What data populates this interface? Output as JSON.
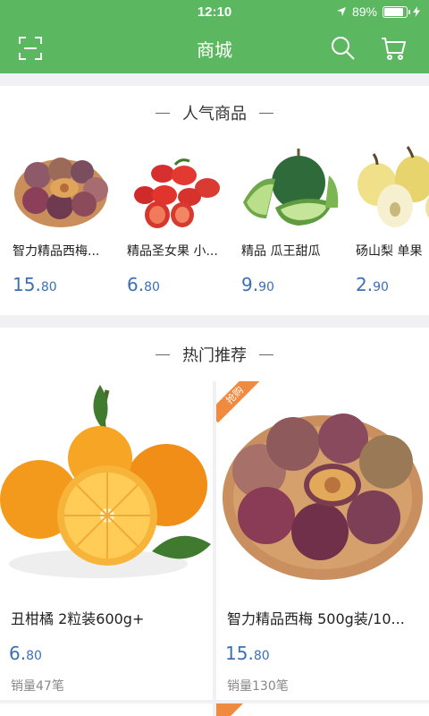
{
  "status": {
    "time": "12:10",
    "battery": "89%"
  },
  "navbar": {
    "title": "商城"
  },
  "popular": {
    "title": "人气商品",
    "items": [
      {
        "name": "智力精品西梅...",
        "price_int": "15.",
        "price_dec": "80"
      },
      {
        "name": "精品圣女果 小...",
        "price_int": "6.",
        "price_dec": "80"
      },
      {
        "name": "精品 瓜王甜瓜",
        "price_int": "9.",
        "price_dec": "90"
      },
      {
        "name": "砀山梨  单果",
        "price_int": "2.",
        "price_dec": "90"
      }
    ]
  },
  "hot": {
    "title": "热门推荐",
    "items": [
      {
        "name": "丑柑橘  2粒装600g+",
        "price_int": "6.",
        "price_dec": "80",
        "sales": "销量47笔",
        "tag": ""
      },
      {
        "name": "智力精品西梅 500g装/10...",
        "price_int": "15.",
        "price_dec": "80",
        "sales": "销量130笔",
        "tag": "抢购"
      }
    ]
  },
  "colors": {
    "primary": "#5cb860",
    "price": "#3b6fb6",
    "tag": "#f08a3e"
  }
}
